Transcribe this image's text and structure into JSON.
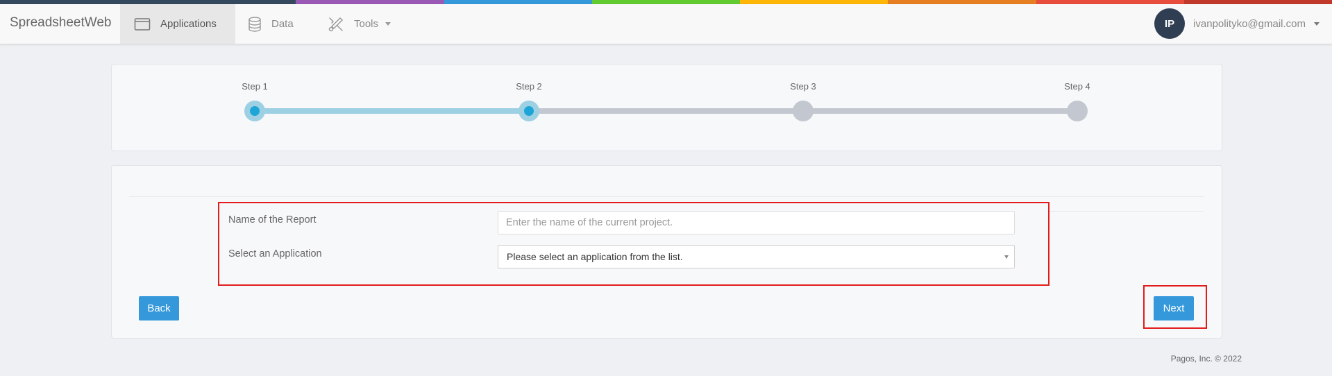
{
  "brand_colors": [
    "#34495e",
    "#9b59b6",
    "#3498db",
    "#62cb31",
    "#ffb606",
    "#e67e22",
    "#e74c3c",
    "#c0392b"
  ],
  "header": {
    "brand": "SpreadsheetWeb",
    "nav": [
      {
        "label": "Applications",
        "icon": "window-icon",
        "active": true
      },
      {
        "label": "Data",
        "icon": "database-icon",
        "active": false
      },
      {
        "label": "Tools",
        "icon": "tools-icon",
        "active": false,
        "has_dropdown": true
      }
    ],
    "user": {
      "initials": "IP",
      "email": "ivanpolityko@gmail.com"
    }
  },
  "wizard": {
    "steps": [
      {
        "label": "Step 1",
        "state": "completed"
      },
      {
        "label": "Step 2",
        "state": "current"
      },
      {
        "label": "Step 3",
        "state": "pending"
      },
      {
        "label": "Step 4",
        "state": "pending"
      }
    ],
    "progress_color": "#9dd0e3",
    "pending_color": "#c3c7cf",
    "dot_color": "#1ea5d8"
  },
  "form": {
    "report_name_label": "Name of the Report",
    "report_name_placeholder": "Enter the name of the current project.",
    "report_name_value": "",
    "application_label": "Select an Application",
    "application_selected": "Please select an application from the list."
  },
  "buttons": {
    "back": "Back",
    "next": "Next"
  },
  "footer": {
    "copyright": "Pagos, Inc. © 2022"
  }
}
